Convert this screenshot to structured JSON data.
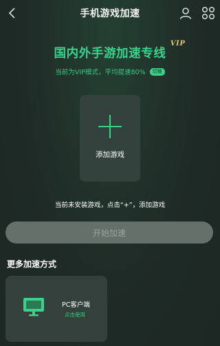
{
  "header": {
    "title": "手机游戏加速"
  },
  "headline": {
    "text": "国内外手游加速专线",
    "badge": "VIP"
  },
  "subline": {
    "text": "当前为VIP模式，平均提速80%",
    "switch_label": "切换"
  },
  "add_card": {
    "label": "添加游戏"
  },
  "hint": "当前未安装游戏，点击“+”，添加游戏",
  "start_button": "开始加速",
  "more_section": {
    "title": "更多加速方式",
    "pc_card": {
      "title": "PC客户端",
      "subtitle": "点击使用"
    }
  },
  "colors": {
    "accent": "#3fd18a",
    "background": "#1f2a26",
    "card": "#33423c",
    "button_disabled": "#65706b"
  },
  "icons": [
    "back-chevron-icon",
    "user-icon",
    "apps-grid-icon",
    "plus-icon",
    "monitor-icon"
  ]
}
